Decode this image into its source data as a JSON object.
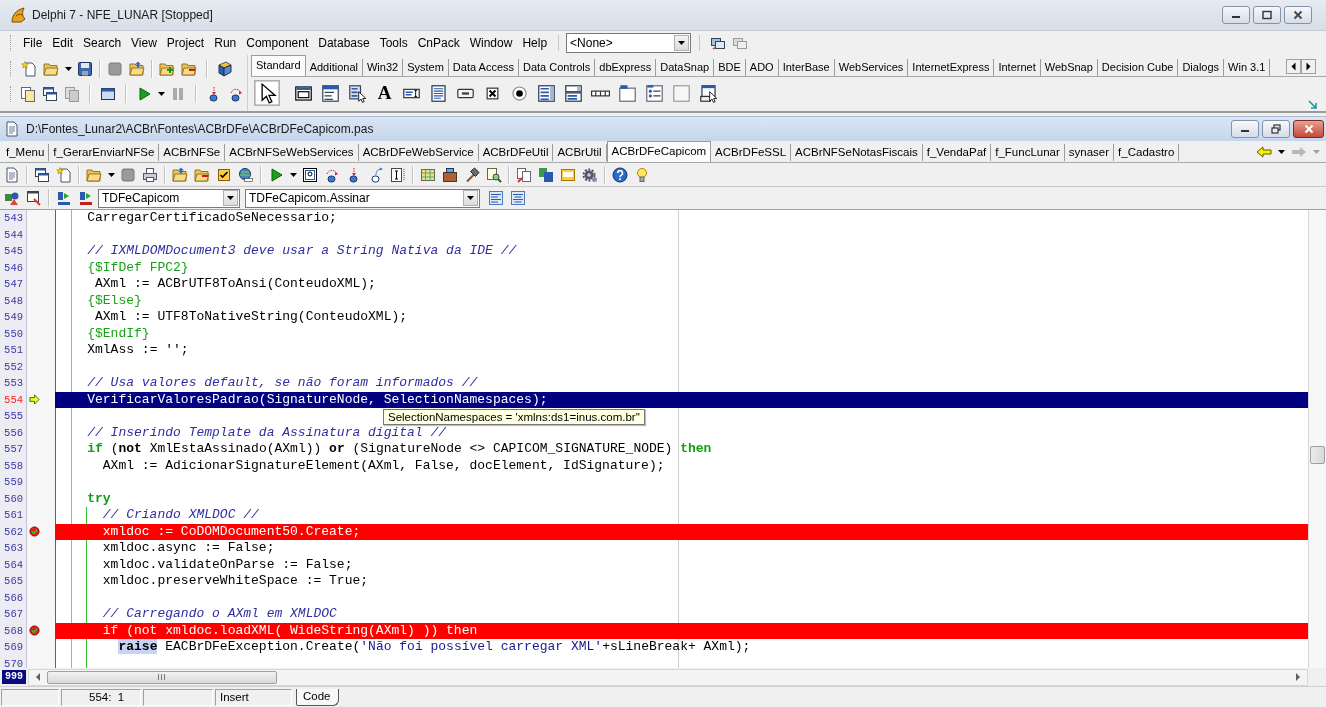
{
  "window": {
    "title": "Delphi 7 - NFE_LUNAR [Stopped]"
  },
  "menu": [
    "File",
    "Edit",
    "Search",
    "View",
    "Project",
    "Run",
    "Component",
    "Database",
    "Tools",
    "CnPack",
    "Window",
    "Help"
  ],
  "desktop_combo": {
    "value": "<None>"
  },
  "palette": {
    "tabs": [
      {
        "label": "Standard",
        "selected": true
      },
      {
        "label": "Additional",
        "selected": false
      },
      {
        "label": "Win32",
        "selected": false
      },
      {
        "label": "System",
        "selected": false
      },
      {
        "label": "Data Access",
        "selected": false
      },
      {
        "label": "Data Controls",
        "selected": false
      },
      {
        "label": "dbExpress",
        "selected": false
      },
      {
        "label": "DataSnap",
        "selected": false
      },
      {
        "label": "BDE",
        "selected": false
      },
      {
        "label": "ADO",
        "selected": false
      },
      {
        "label": "InterBase",
        "selected": false
      },
      {
        "label": "WebServices",
        "selected": false
      },
      {
        "label": "InternetExpress",
        "selected": false
      },
      {
        "label": "Internet",
        "selected": false
      },
      {
        "label": "WebSnap",
        "selected": false
      },
      {
        "label": "Decision Cube",
        "selected": false
      },
      {
        "label": "Dialogs",
        "selected": false
      },
      {
        "label": "Win 3.1",
        "selected": false
      }
    ],
    "label_tool_glyph": "A"
  },
  "editor": {
    "title": "D:\\Fontes_Lunar2\\ACBr\\Fontes\\ACBrDFe\\ACBrDFeCapicom.pas",
    "tabs": [
      {
        "label": "f_Menu",
        "selected": false
      },
      {
        "label": "f_GerarEnviarNFSe",
        "selected": false
      },
      {
        "label": "ACBrNFSe",
        "selected": false
      },
      {
        "label": "ACBrNFSeWebServices",
        "selected": false
      },
      {
        "label": "ACBrDFeWebService",
        "selected": false
      },
      {
        "label": "ACBrDFeUtil",
        "selected": false
      },
      {
        "label": "ACBrUtil",
        "selected": false
      },
      {
        "label": "ACBrDFeCapicom",
        "selected": true
      },
      {
        "label": "ACBrDFeSSL",
        "selected": false
      },
      {
        "label": "ACBrNFSeNotasFiscais",
        "selected": false
      },
      {
        "label": "f_VendaPaf",
        "selected": false
      },
      {
        "label": "f_FuncLunar",
        "selected": false
      },
      {
        "label": "synaser",
        "selected": false
      },
      {
        "label": "f_Cadastro",
        "selected": false
      }
    ],
    "class_combo": {
      "value": "TDFeCapicom"
    },
    "method_combo": {
      "value": "TDFeCapicom.Assinar"
    },
    "lines": [
      {
        "number": "543",
        "execution_point": false,
        "breakpoint": false,
        "tokens": [
          {
            "kind": "plain",
            "text": "    CarregarCertificadoSeNecessario;"
          }
        ]
      },
      {
        "number": "544",
        "execution_point": false,
        "breakpoint": false
      },
      {
        "number": "545",
        "execution_point": false,
        "breakpoint": false,
        "tokens": [
          {
            "kind": "comment",
            "text": "    // IXMLDOMDocument3 deve usar a String Nativa da IDE //"
          }
        ]
      },
      {
        "number": "546",
        "execution_point": false,
        "breakpoint": false,
        "tokens": [
          {
            "kind": "directive",
            "text": "    {$IfDef FPC2}"
          }
        ]
      },
      {
        "number": "547",
        "execution_point": false,
        "breakpoint": false,
        "tokens": [
          {
            "kind": "plain",
            "text": "     AXml := ACBrUTF8ToAnsi(ConteudoXML);"
          }
        ]
      },
      {
        "number": "548",
        "execution_point": false,
        "breakpoint": false,
        "tokens": [
          {
            "kind": "directive",
            "text": "    {$Else}"
          }
        ]
      },
      {
        "number": "549",
        "execution_point": false,
        "breakpoint": false,
        "tokens": [
          {
            "kind": "plain",
            "text": "     AXml := UTF8ToNativeString(ConteudoXML);"
          }
        ]
      },
      {
        "number": "550",
        "execution_point": false,
        "breakpoint": false,
        "tokens": [
          {
            "kind": "directive",
            "text": "    {$EndIf}"
          }
        ]
      },
      {
        "number": "551",
        "execution_point": false,
        "breakpoint": false,
        "tokens": [
          {
            "kind": "plain",
            "text": "    XmlAss := '';"
          }
        ]
      },
      {
        "number": "552",
        "execution_point": false,
        "breakpoint": false
      },
      {
        "number": "553",
        "execution_point": false,
        "breakpoint": false,
        "tokens": [
          {
            "kind": "comment",
            "text": "    // Usa valores default, se não foram informados //"
          }
        ]
      },
      {
        "number": "554",
        "execution_point": true,
        "breakpoint": false,
        "tokens": [
          {
            "kind": "plain",
            "text": "    VerificarValoresPadrao(SignatureNode, SelectionNamespaces);"
          }
        ]
      },
      {
        "number": "555",
        "execution_point": false,
        "breakpoint": false
      },
      {
        "number": "556",
        "execution_point": false,
        "breakpoint": false,
        "tokens": [
          {
            "kind": "comment",
            "text": "    // Inserindo Template da Assinatura digital //"
          }
        ]
      },
      {
        "number": "557",
        "execution_point": false,
        "breakpoint": false,
        "tokens": [
          {
            "kind": "block_keyword",
            "text": "    if"
          },
          {
            "kind": "plain",
            "text": " ("
          },
          {
            "kind": "keyword",
            "text": "not"
          },
          {
            "kind": "plain",
            "text": " XmlEstaAssinado(AXml)) "
          },
          {
            "kind": "keyword",
            "text": "or"
          },
          {
            "kind": "plain",
            "text": " (SignatureNode <> CAPICOM_SIGNATURE_NODE) "
          },
          {
            "kind": "block_keyword",
            "text": "then"
          }
        ]
      },
      {
        "number": "558",
        "execution_point": false,
        "breakpoint": false,
        "tokens": [
          {
            "kind": "plain",
            "text": "      AXml := AdicionarSignatureElement(AXml, False, docElement, IdSignature);"
          }
        ]
      },
      {
        "number": "559",
        "execution_point": false,
        "breakpoint": false
      },
      {
        "number": "560",
        "execution_point": false,
        "breakpoint": false,
        "tokens": [
          {
            "kind": "block_keyword",
            "text": "    try"
          }
        ]
      },
      {
        "number": "561",
        "execution_point": false,
        "breakpoint": false,
        "tokens": [
          {
            "kind": "comment",
            "text": "      // Criando XMLDOC //"
          }
        ]
      },
      {
        "number": "562",
        "execution_point": false,
        "breakpoint": true,
        "tokens": [
          {
            "kind": "plain",
            "text": "      xmldoc := CoDOMDocument50.Create;"
          }
        ]
      },
      {
        "number": "563",
        "execution_point": false,
        "breakpoint": false,
        "tokens": [
          {
            "kind": "plain",
            "text": "      xmldoc.async := False;"
          }
        ]
      },
      {
        "number": "564",
        "execution_point": false,
        "breakpoint": false,
        "tokens": [
          {
            "kind": "plain",
            "text": "      xmldoc.validateOnParse := False;"
          }
        ]
      },
      {
        "number": "565",
        "execution_point": false,
        "breakpoint": false,
        "tokens": [
          {
            "kind": "plain",
            "text": "      xmldoc.preserveWhiteSpace := True;"
          }
        ]
      },
      {
        "number": "566",
        "execution_point": false,
        "breakpoint": false
      },
      {
        "number": "567",
        "execution_point": false,
        "breakpoint": false,
        "tokens": [
          {
            "kind": "comment",
            "text": "      // Carregando o AXml em XMLDOC"
          }
        ]
      },
      {
        "number": "568",
        "execution_point": false,
        "breakpoint": true,
        "tokens": [
          {
            "kind": "plain",
            "text": "      if (not xmldoc.loadXML( WideString(AXml) )) then"
          }
        ]
      },
      {
        "number": "569",
        "execution_point": false,
        "breakpoint": false,
        "tokens": [
          {
            "kind": "marked_keyword",
            "text": "        raise"
          },
          {
            "kind": "plain",
            "text": " EACBrDFeException.Create("
          },
          {
            "kind": "string",
            "text": "'Não foi possível carregar XML'"
          },
          {
            "kind": "plain",
            "text": "+sLineBreak+ AXml);"
          }
        ]
      },
      {
        "number": "570",
        "execution_point": false,
        "breakpoint": false
      }
    ],
    "tooltip": "SelectionNamespaces = 'xmlns:ds1=inus.com.br''",
    "bottom_line_number": "999"
  },
  "status_bar": {
    "position": "554:  1",
    "mode": "Insert",
    "view_tab": "Code"
  }
}
